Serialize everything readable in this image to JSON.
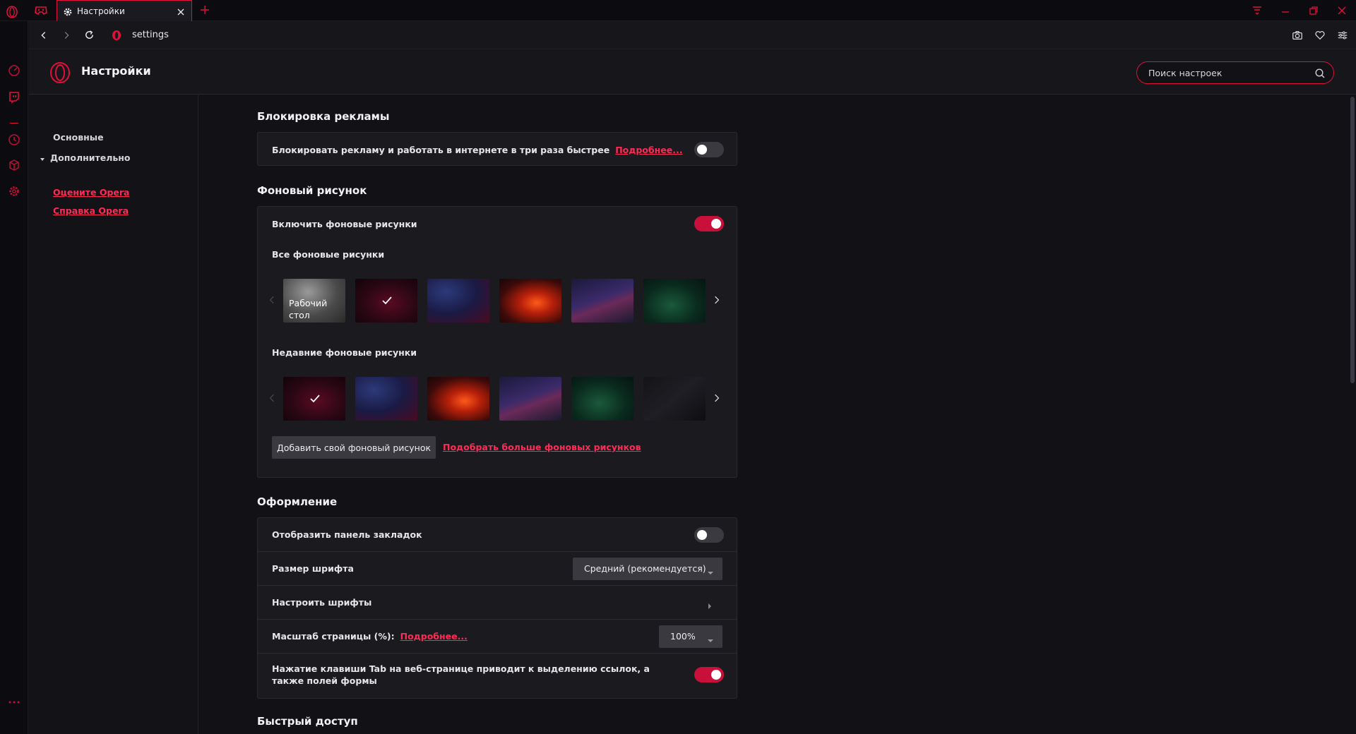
{
  "browser": {
    "tab_title": "Настройки",
    "url": "settings",
    "accent": "#e0103a"
  },
  "header": {
    "title": "Настройки",
    "search_placeholder": "Поиск настроек"
  },
  "nav": {
    "basic": "Основные",
    "advanced": "Дополнительно",
    "rate": "Оцените Opera",
    "help": "Справка Opera"
  },
  "ad_block": {
    "title": "Блокировка рекламы",
    "label": "Блокировать рекламу и работать в интернете в три раза быстрее",
    "link": "Подробнее...",
    "enabled": false
  },
  "wallpaper": {
    "title": "Фоновый рисунок",
    "enable_label": "Включить фоновые рисунки",
    "enabled": true,
    "all_label": "Все фоновые рисунки",
    "desktop_label": "Рабочий стол",
    "recent_label": "Недавние фоновые рисунки",
    "add_button": "Добавить свой фоновый рисунок",
    "more_link": "Подобрать больше фоновых рисунков"
  },
  "appearance": {
    "title": "Оформление",
    "bookmarks_label": "Отобразить панель закладок",
    "bookmarks_enabled": false,
    "font_size_label": "Размер шрифта",
    "font_size_value": "Средний (рекомендуется)",
    "fonts_label": "Настроить шрифты",
    "zoom_label": "Масштаб страницы (%):",
    "zoom_link": "Подробнее...",
    "zoom_value": "100%",
    "tab_label": "Нажатие клавиши Tab на веб-странице приводит к выделению ссылок, а также полей формы",
    "tab_enabled": true
  },
  "speed_dial": {
    "title": "Быстрый доступ"
  }
}
